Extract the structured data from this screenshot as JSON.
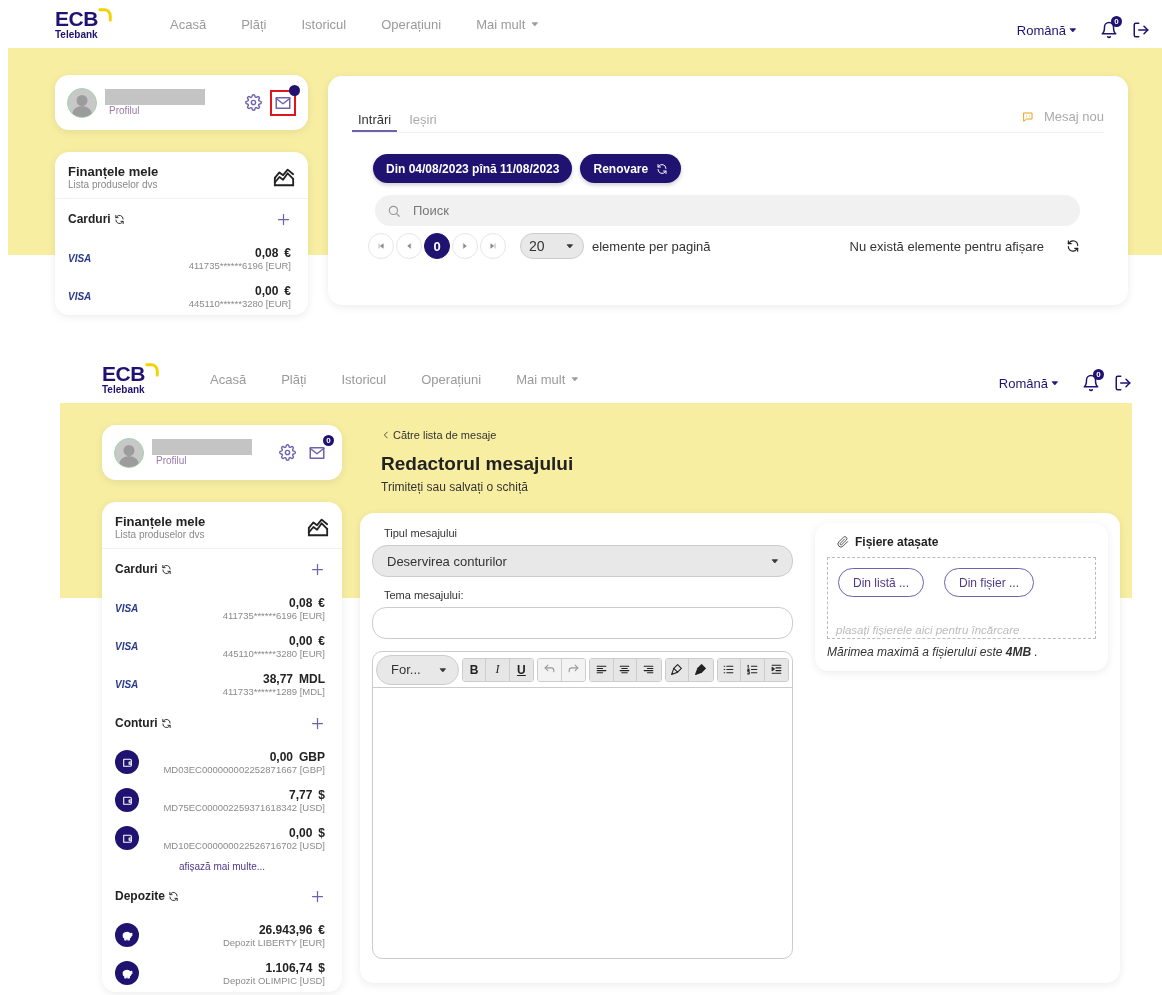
{
  "screens": [
    {
      "kind": "inbox",
      "nav": {
        "logo": "ECB",
        "logo_sub": "Telebank",
        "links": [
          "Acasă",
          "Plăți",
          "Istoricul",
          "Operațiuni"
        ],
        "more": "Mai mult",
        "language": "Română",
        "bell_count": "0"
      },
      "profile": {
        "label": "Profilul",
        "mail": {
          "highlighted": true
        }
      },
      "finances": {
        "title": "Finanțele mele",
        "subtitle": "Lista produselor dvs",
        "sections": [
          {
            "title": "Carduri",
            "items": [
              {
                "kind": "card",
                "brand": "VISA",
                "amount": "0,08",
                "currency": "€",
                "detail": "411735******6196 [EUR]"
              },
              {
                "kind": "card",
                "brand": "VISA",
                "amount": "0,00",
                "currency": "€",
                "detail": "445110******3280 [EUR]"
              }
            ]
          }
        ]
      },
      "inbox": {
        "tabs": [
          {
            "label": "Intrări",
            "selected": true
          },
          {
            "label": "Ieșiri",
            "selected": false
          }
        ],
        "new_message": "Mesaj nou",
        "date_range": "Din 04/08/2023 pînă 11/08/2023",
        "renew": "Renovare",
        "search_placeholder": "Поиск",
        "pages": [
          {
            "label": "0",
            "selected": true
          }
        ],
        "per_page": "20",
        "per_page_label": "elemente per pagină",
        "empty_text": "Nu există elemente pentru afișare"
      }
    },
    {
      "kind": "editor",
      "nav": {
        "logo": "ECB",
        "logo_sub": "Telebank",
        "links": [
          "Acasă",
          "Plăți",
          "Istoricul",
          "Operațiuni"
        ],
        "more": "Mai mult",
        "language": "Română",
        "bell_count": "0"
      },
      "profile": {
        "label": "Profilul",
        "mail": {
          "highlighted": false,
          "count": "0"
        }
      },
      "finances": {
        "title": "Finanțele mele",
        "subtitle": "Lista produselor dvs",
        "sections": [
          {
            "title": "Carduri",
            "items": [
              {
                "kind": "card",
                "brand": "VISA",
                "amount": "0,08",
                "currency": "€",
                "detail": "411735******6196 [EUR]"
              },
              {
                "kind": "card",
                "brand": "VISA",
                "amount": "0,00",
                "currency": "€",
                "detail": "445110******3280 [EUR]"
              },
              {
                "kind": "card",
                "brand": "VISA",
                "amount": "38,77",
                "currency": "MDL",
                "detail": "411733******1289 [MDL]"
              }
            ]
          },
          {
            "title": "Conturi",
            "more": "afișază mai multe...",
            "items": [
              {
                "kind": "account",
                "amount": "0,00",
                "currency": "GBP",
                "detail": "MD03EC000000002252871667 [GBP]"
              },
              {
                "kind": "account",
                "amount": "7,77",
                "currency": "$",
                "detail": "MD75EC000002259371618342 [USD]"
              },
              {
                "kind": "account",
                "amount": "0,00",
                "currency": "$",
                "detail": "MD10EC000000022526716702 [USD]"
              }
            ]
          },
          {
            "title": "Depozite",
            "items": [
              {
                "kind": "deposit",
                "amount": "26.943,96",
                "currency": "€",
                "detail": "Depozit LIBERTY [EUR]"
              },
              {
                "kind": "deposit",
                "amount": "1.106,74",
                "currency": "$",
                "detail": "Depozit OLIMPIC [USD]"
              }
            ]
          }
        ]
      },
      "editor": {
        "back": "Către lista de mesaje",
        "title": "Redactorul mesajului",
        "subtitle": "Trimiteți sau salvați o schiță",
        "type_label": "Tipul mesajului",
        "type_value": "Deservirea conturilor",
        "topic_label": "Tema mesajului:",
        "format": "For...",
        "toolbar": [
          [
            {
              "kind": "bold",
              "label": "B",
              "disabled": false
            },
            {
              "kind": "italic",
              "label": "I",
              "disabled": false
            },
            {
              "kind": "underline",
              "label": "U",
              "disabled": false
            }
          ],
          [
            {
              "kind": "undo",
              "disabled": true
            },
            {
              "kind": "redo",
              "disabled": true
            }
          ],
          [
            {
              "kind": "align-left",
              "disabled": false
            },
            {
              "kind": "align-center",
              "disabled": false
            },
            {
              "kind": "align-right",
              "disabled": false
            }
          ],
          [
            {
              "kind": "brush",
              "disabled": false
            },
            {
              "kind": "brush-fill",
              "disabled": false
            }
          ],
          [
            {
              "kind": "bullet-list",
              "disabled": false
            },
            {
              "kind": "number-list",
              "disabled": false
            },
            {
              "kind": "indent",
              "disabled": false
            }
          ]
        ],
        "attachments": {
          "title": "Fișiere atașate",
          "buttons": [
            "Din listă ...",
            "Din fișier ..."
          ],
          "drop_placeholder": "plasați fișierele aici pentru încărcare",
          "note": "Mărimea maximă a fișierului este **4MB** ."
        }
      }
    }
  ]
}
